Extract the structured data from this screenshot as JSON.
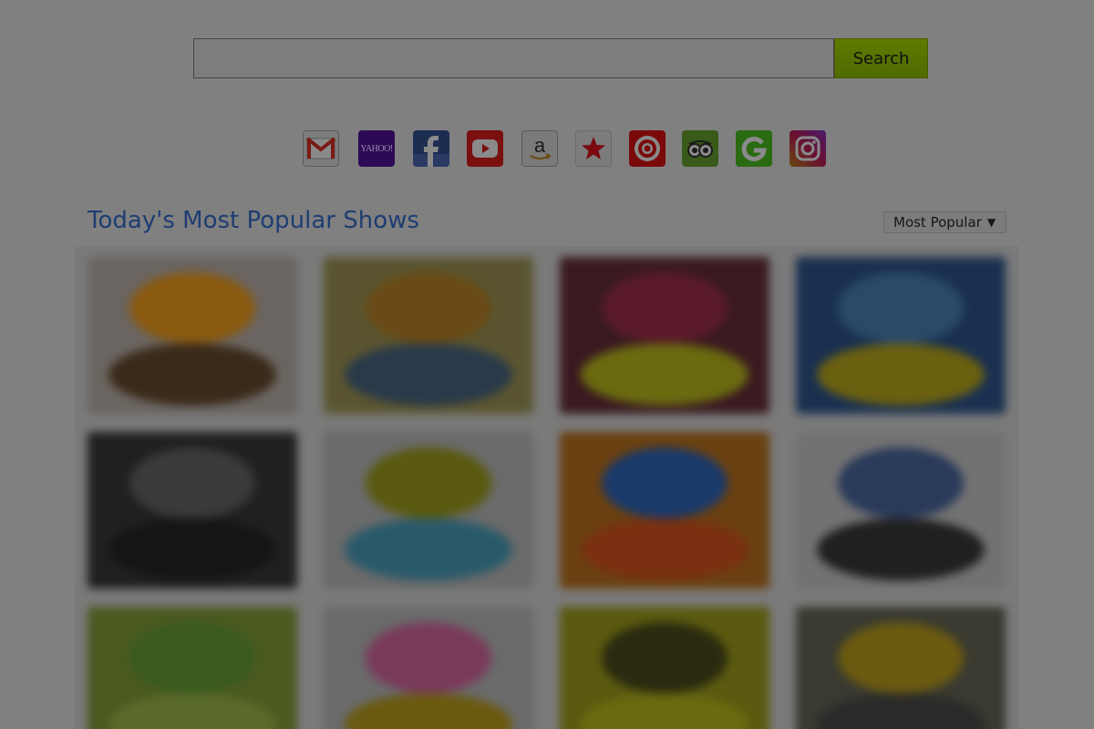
{
  "search": {
    "placeholder": "",
    "value": "",
    "button_label": "Search"
  },
  "quick_links": [
    {
      "name": "Gmail",
      "icon": "gmail-icon",
      "color": "#7a1a14"
    },
    {
      "name": "Yahoo",
      "icon": "yahoo-icon",
      "label": "YAHOO!",
      "color": "#2d0a55"
    },
    {
      "name": "Facebook",
      "icon": "facebook-icon",
      "color": "#1d2d52"
    },
    {
      "name": "YouTube",
      "icon": "youtube-icon",
      "color": "#7a1010"
    },
    {
      "name": "Amazon",
      "icon": "amazon-icon",
      "label": "a",
      "color": "#6a6a6a"
    },
    {
      "name": "Macy's",
      "icon": "star-icon",
      "color": "#7a0a10"
    },
    {
      "name": "Target",
      "icon": "target-icon",
      "color": "#7a0a0a"
    },
    {
      "name": "TripAdvisor",
      "icon": "owl-icon",
      "color": "#3a5a1a"
    },
    {
      "name": "Groupon",
      "icon": "groupon-icon",
      "color": "#2a6a10"
    },
    {
      "name": "Instagram",
      "icon": "instagram-icon",
      "color": "#6a1a4a"
    }
  ],
  "section": {
    "title": "Today's Most Popular Shows",
    "sort": {
      "selected": "Most Popular",
      "arrow": "▼"
    }
  },
  "shows": [
    {
      "bg": "#6a6560",
      "accent": "#8a5a10",
      "accent2": "#3a2a1a"
    },
    {
      "bg": "#5a5530",
      "accent": "#6a4a15",
      "accent2": "#2a3a4a"
    },
    {
      "bg": "#3a1a20",
      "accent": "#5a1a2a",
      "accent2": "#6a6a10"
    },
    {
      "bg": "#1a3050",
      "accent": "#2a4a6a",
      "accent2": "#6a6010"
    },
    {
      "bg": "#202020",
      "accent": "#3a3a3a",
      "accent2": "#151515"
    },
    {
      "bg": "#6a6a6a",
      "accent": "#5a5a10",
      "accent2": "#2a5a6a"
    },
    {
      "bg": "#6a4010",
      "accent": "#1a3a6a",
      "accent2": "#7a3010"
    },
    {
      "bg": "#727272",
      "accent": "#2a3a5a",
      "accent2": "#202020"
    },
    {
      "bg": "#4a5a20",
      "accent": "#3a5a20",
      "accent2": "#5a6a2a"
    },
    {
      "bg": "#6a6a6a",
      "accent": "#7a3a5a",
      "accent2": "#6a5a10"
    },
    {
      "bg": "#5a5a10",
      "accent": "#2a2a10",
      "accent2": "#6a6a10"
    },
    {
      "bg": "#3a3a30",
      "accent": "#6a5a10",
      "accent2": "#2a2a2a"
    }
  ]
}
